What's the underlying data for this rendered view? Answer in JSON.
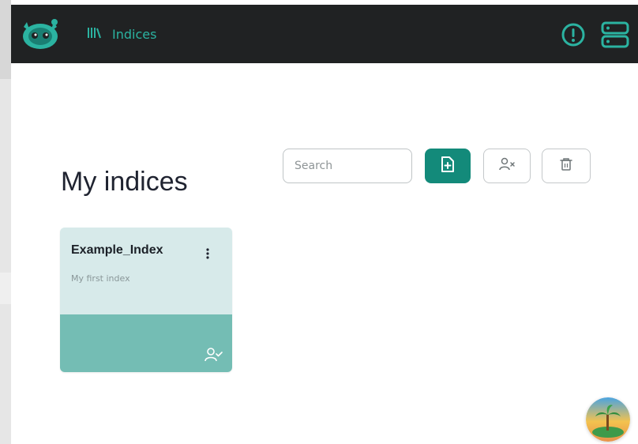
{
  "header": {
    "nav_label": "Indices",
    "colors": {
      "bar": "#202223",
      "accent": "#2bb3a1"
    },
    "icons": [
      "logo-icon",
      "library-icon",
      "info-icon",
      "server-icon"
    ]
  },
  "main": {
    "title": "My indices",
    "search": {
      "placeholder": "Search",
      "value": ""
    },
    "actions": [
      {
        "name": "new-index-button",
        "icon": "add-document-icon"
      },
      {
        "name": "user-filter-button",
        "icon": "user-x-icon"
      },
      {
        "name": "delete-button",
        "icon": "trash-icon"
      }
    ],
    "accent": "#138a7a"
  },
  "indices": [
    {
      "name": "Example_Index",
      "description": "My first index",
      "owner_icon": "user-check-icon"
    }
  ],
  "avatar": {
    "icon": "island-avatar-icon"
  }
}
